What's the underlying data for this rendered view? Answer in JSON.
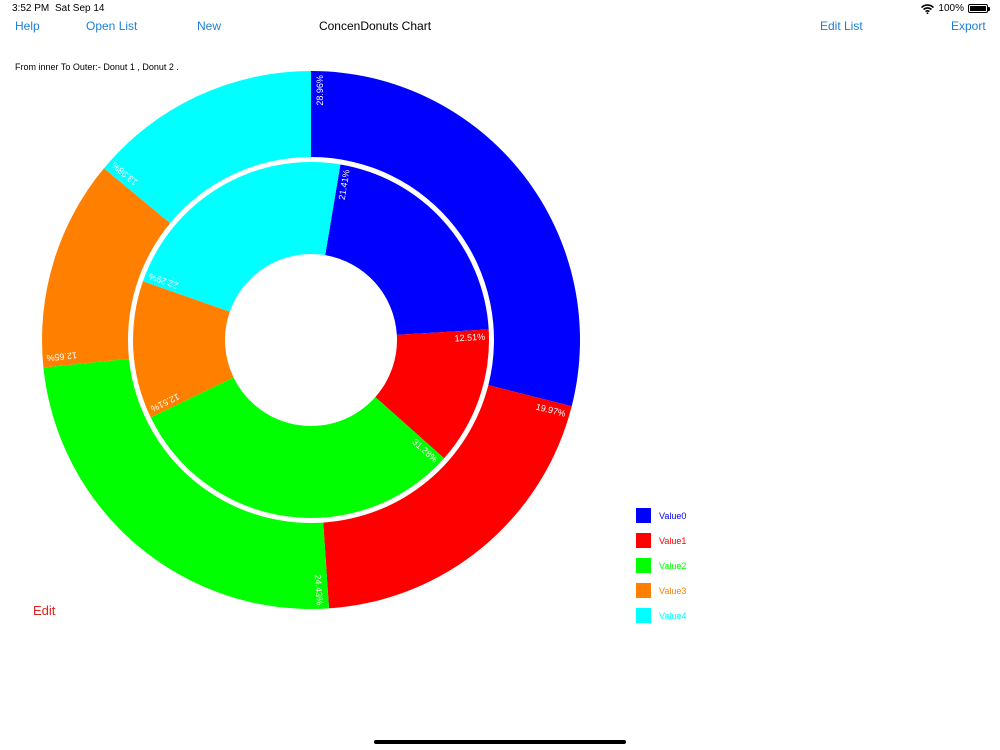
{
  "status_bar": {
    "time": "3:52 PM",
    "date": "Sat Sep 14",
    "battery": "100%",
    "battery_level": 1.0
  },
  "nav": {
    "help": "Help",
    "open_list": "Open List",
    "new": "New",
    "title": "ConcenDonuts Chart",
    "edit_list": "Edit List",
    "export": "Export"
  },
  "subtitle": "From inner To Outer:- Donut 1 ,  Donut 2 .",
  "edit_label": "Edit",
  "colors": {
    "Value0": "#0000ff",
    "Value1": "#ff0000",
    "Value2": "#00ff00",
    "Value3": "#ff8000",
    "Value4": "#00ffff"
  },
  "chart_data": {
    "type": "pie",
    "categories": [
      "Value0",
      "Value1",
      "Value2",
      "Value3",
      "Value4"
    ],
    "series": [
      {
        "name": "Donut 1",
        "values": [
          21.41,
          12.51,
          31.28,
          12.51,
          22.29
        ],
        "labels": [
          "21.41%",
          "12.51%",
          "31.28%",
          "12.51%",
          "22.29%"
        ]
      },
      {
        "name": "Donut 2",
        "values": [
          28.96,
          19.97,
          24.43,
          12.65,
          13.98
        ],
        "labels": [
          "28.96%",
          "19.97%",
          "24.43%",
          "12.65%",
          "13.98%"
        ]
      }
    ],
    "legend": [
      "Value0",
      "Value1",
      "Value2",
      "Value3",
      "Value4"
    ],
    "legend_position": "bottom-right"
  }
}
